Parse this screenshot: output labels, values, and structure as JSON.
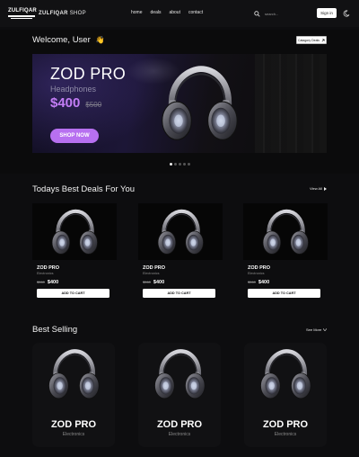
{
  "nav": {
    "logo_text": "ZULFIQAR",
    "brand_name": "ZULFIQAR",
    "brand_suffix": "SHOP",
    "menu": [
      "home",
      "deals",
      "about",
      "contact"
    ],
    "search_placeholder": "search...",
    "signin_label": "Sign in",
    "theme_icon": "moon-icon"
  },
  "welcome": {
    "greeting": "Welcome, User",
    "wave": "👋",
    "category_button": "Catagory Deals"
  },
  "hero": {
    "title": "ZOD PRO",
    "subtitle": "Headphones",
    "price": "$400",
    "old_price": "$500",
    "cta": "SHOP NOW",
    "slide_count": 5,
    "active_slide": 0
  },
  "deals": {
    "title": "Todays Best Deals For You",
    "view_all": "View All",
    "items": [
      {
        "name": "ZOD PRO",
        "category": "Electronics",
        "old_price": "$560",
        "price": "$400",
        "cart": "ADD TO CART"
      },
      {
        "name": "ZOD PRO",
        "category": "Electronics",
        "old_price": "$560",
        "price": "$400",
        "cart": "ADD TO CART"
      },
      {
        "name": "ZOD PRO",
        "category": "Electronics",
        "old_price": "$560",
        "price": "$400",
        "cart": "ADD TO CART"
      }
    ]
  },
  "best": {
    "title": "Best Selling",
    "see_more": "See More",
    "items": [
      {
        "name": "ZOD PRO",
        "category": "Electronics"
      },
      {
        "name": "ZOD PRO",
        "category": "Electronics"
      },
      {
        "name": "ZOD PRO",
        "category": "Electronics"
      }
    ]
  },
  "colors": {
    "accent": "#b770f0",
    "price_accent": "#c27df5",
    "background": "#0d0d0f"
  }
}
